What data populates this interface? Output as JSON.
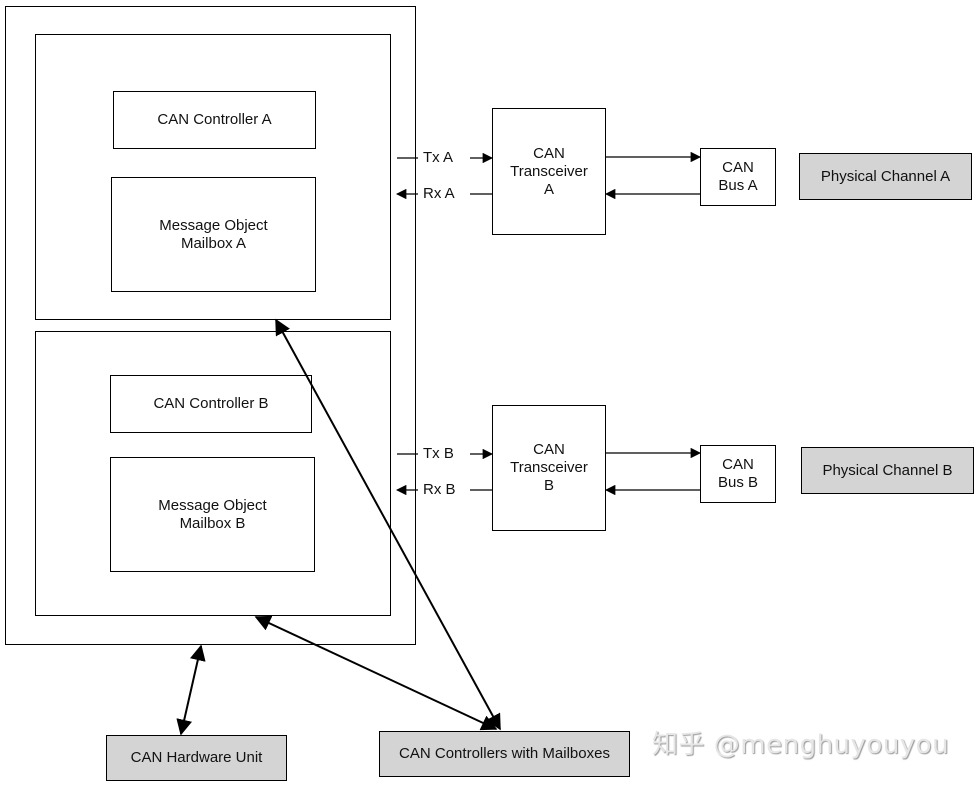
{
  "diagram": {
    "controllers": [
      {
        "name": "CAN Controller A",
        "mailbox": "Message Object\nMailbox A"
      },
      {
        "name": "CAN Controller B",
        "mailbox": "Message Object\nMailbox B"
      }
    ],
    "signals": {
      "tx_a": "Tx A",
      "rx_a": "Rx A",
      "tx_b": "Tx B",
      "rx_b": "Rx B"
    },
    "transceivers": [
      {
        "label": "CAN\nTransceiver\nA"
      },
      {
        "label": "CAN\nTransceiver\nB"
      }
    ],
    "buses": [
      {
        "label": "CAN\nBus A"
      },
      {
        "label": "CAN\nBus B"
      }
    ],
    "physical_channels": [
      {
        "label": "Physical Channel A"
      },
      {
        "label": "Physical Channel B"
      }
    ],
    "bottom_labels": {
      "hardware_unit": "CAN Hardware Unit",
      "controllers_with_mailboxes": "CAN Controllers with Mailboxes"
    },
    "colors": {
      "line": "#000000",
      "legend_box_fill": "#d4d4d4"
    }
  },
  "watermark": "知乎 @menghuyouyou"
}
